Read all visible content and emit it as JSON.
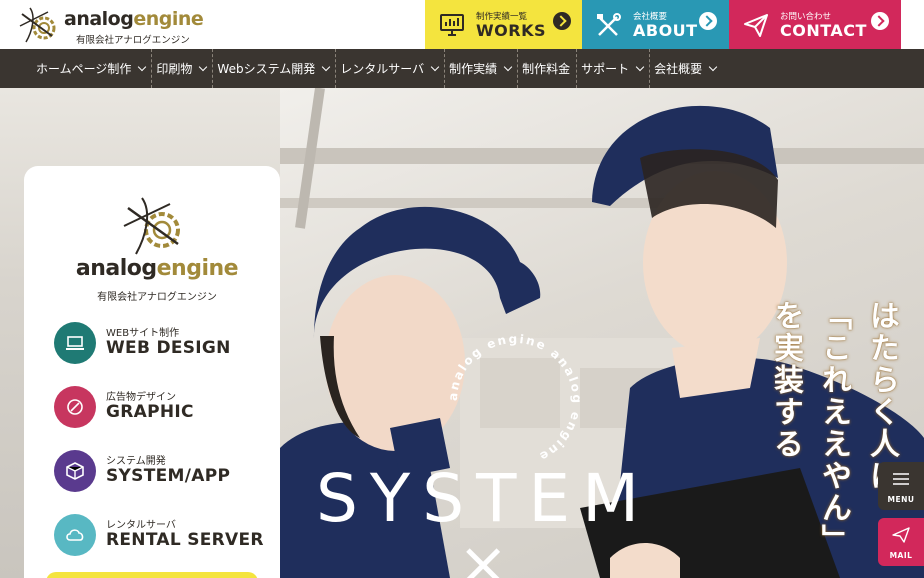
{
  "header": {
    "logo_name_a": "analog",
    "logo_name_b": "engine",
    "logo_sub": "有限会社アナログエンジン",
    "works": {
      "small": "制作実績一覧",
      "big": "WORKS"
    },
    "about": {
      "small": "会社概要",
      "big": "ABOUT"
    },
    "contact": {
      "small": "お問い合わせ",
      "big": "CONTACT"
    }
  },
  "nav": {
    "items": [
      {
        "label": "ホームページ制作"
      },
      {
        "label": "印刷物"
      },
      {
        "label": "Webシステム開発"
      },
      {
        "label": "レンタルサーバ"
      },
      {
        "label": "制作実績"
      },
      {
        "label": "制作料金"
      },
      {
        "label": "サポート"
      },
      {
        "label": "会社概要"
      }
    ]
  },
  "card": {
    "logo_name_a": "analog",
    "logo_name_b": "engine",
    "logo_sub": "有限会社アナログエンジン",
    "services": [
      {
        "small": "WEBサイト制作",
        "big": "WEB DESIGN",
        "color": "#1f7a74"
      },
      {
        "small": "広告物デザイン",
        "big": "GRAPHIC",
        "color": "#c7365f"
      },
      {
        "small": "システム開発",
        "big": "SYSTEM/APP",
        "color": "#5a3a8e"
      },
      {
        "small": "レンタルサーバ",
        "big": "RENTAL SERVER",
        "color": "#58b8c3"
      }
    ]
  },
  "hero": {
    "catch_1": "はたらく人に",
    "catch_2": "「これええやん」",
    "catch_3": "を実装する",
    "system_word": "SYSTEM",
    "cross": "×",
    "ring_text": "analog engine analog engine "
  },
  "float": {
    "menu": "MENU",
    "mail": "MAIL"
  },
  "colors": {
    "yellow": "#f4e43e",
    "blue": "#2998b4",
    "pink": "#d2285b",
    "dark": "#3a3530",
    "gold": "#a28a3a"
  }
}
